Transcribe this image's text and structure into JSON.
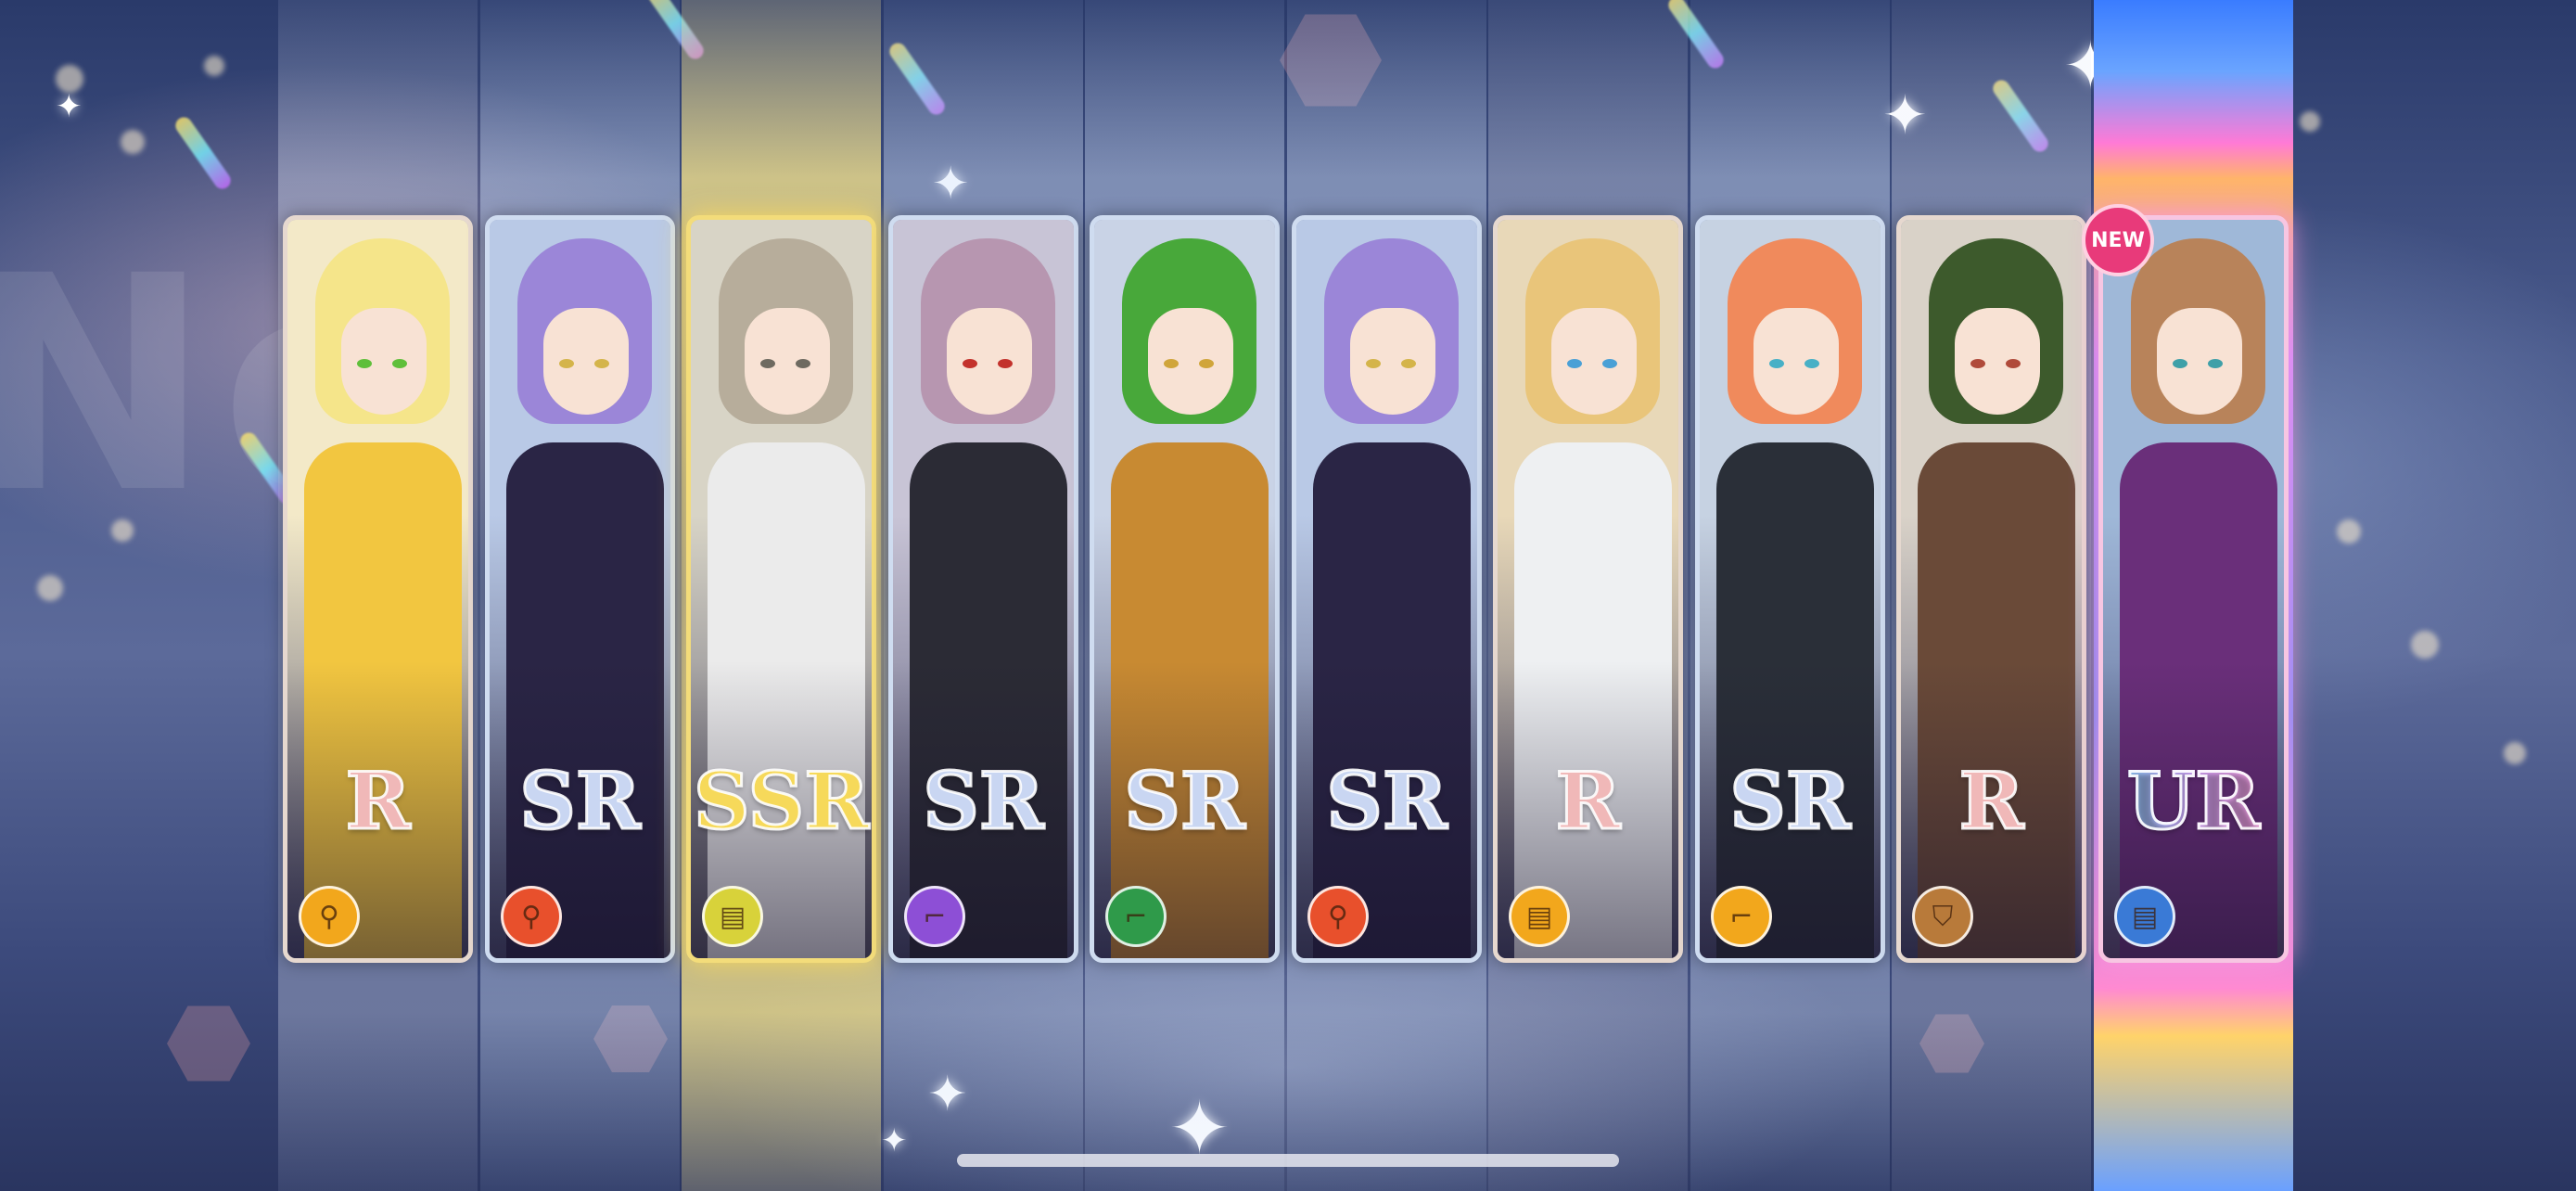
{
  "background": {
    "watermark_text": "Ne"
  },
  "cards": [
    {
      "rarity": "R",
      "rarity_color": "#f0b8b8",
      "border": "#e6d8cf",
      "badge_color": "#f2a71c",
      "badge_icon": "whistle-icon",
      "hair": "#f5e58a",
      "eyes": "#5fbf3a",
      "outfit": "#f2c640",
      "bg": "#f3e9c8"
    },
    {
      "rarity": "SR",
      "rarity_color": "#c9d6f2",
      "border": "#cfdcf0",
      "badge_color": "#e8502c",
      "badge_icon": "whistle-icon",
      "hair": "#9b86d8",
      "eyes": "#d4b44a",
      "outfit": "#2a2545",
      "bg": "#b9c9e6"
    },
    {
      "rarity": "SSR",
      "rarity_color": "#f6d95a",
      "border": "#f3dc7a",
      "badge_color": "#d8d23a",
      "badge_icon": "cards-icon",
      "hair": "#b7ad9b",
      "eyes": "#6e6a60",
      "outfit": "#ebebeb",
      "bg": "#d8d4c6"
    },
    {
      "rarity": "SR",
      "rarity_color": "#c9d6f2",
      "border": "#cfdcf0",
      "badge_color": "#8d4fd6",
      "badge_icon": "boot-icon",
      "hair": "#b796b0",
      "eyes": "#c3322c",
      "outfit": "#2b2b35",
      "bg": "#c8c4d6"
    },
    {
      "rarity": "SR",
      "rarity_color": "#c9d6f2",
      "border": "#cfdcf0",
      "badge_color": "#2f9a4a",
      "badge_icon": "boot-icon",
      "hair": "#48a83a",
      "eyes": "#d0a53a",
      "outfit": "#c88a32",
      "bg": "#c9d3e6"
    },
    {
      "rarity": "SR",
      "rarity_color": "#c9d6f2",
      "border": "#cfdcf0",
      "badge_color": "#e8502c",
      "badge_icon": "whistle-icon",
      "hair": "#9b86d8",
      "eyes": "#d4b44a",
      "outfit": "#2a2545",
      "bg": "#b9c9e6"
    },
    {
      "rarity": "R",
      "rarity_color": "#f0b8b8",
      "border": "#e6d8cf",
      "badge_color": "#f2a71c",
      "badge_icon": "cards-icon",
      "hair": "#e9c57a",
      "eyes": "#4aa0d6",
      "outfit": "#eef0f2",
      "bg": "#e8d8b8"
    },
    {
      "rarity": "SR",
      "rarity_color": "#c9d6f2",
      "border": "#cfdcf0",
      "badge_color": "#f2a71c",
      "badge_icon": "boot-icon",
      "hair": "#f08a5c",
      "eyes": "#48b0c6",
      "outfit": "#2a2f38",
      "bg": "#c6d2e2"
    },
    {
      "rarity": "R",
      "rarity_color": "#f0b8b8",
      "border": "#e6d8cf",
      "badge_color": "#b87a3a",
      "badge_icon": "shield-icon",
      "hair": "#3d5a2c",
      "eyes": "#b04a3a",
      "outfit": "#6a4a38",
      "bg": "#d9d2c8"
    },
    {
      "rarity": "UR",
      "rarity_color": "#c7a8f0",
      "border": "#f7c6e2",
      "badge_color": "#3a7ad6",
      "badge_icon": "cards-icon",
      "hair": "#b8835a",
      "eyes": "#3fa0a8",
      "outfit": "#6a2f7a",
      "bg": "#9fb8d8"
    }
  ],
  "new_badge": "NEW"
}
